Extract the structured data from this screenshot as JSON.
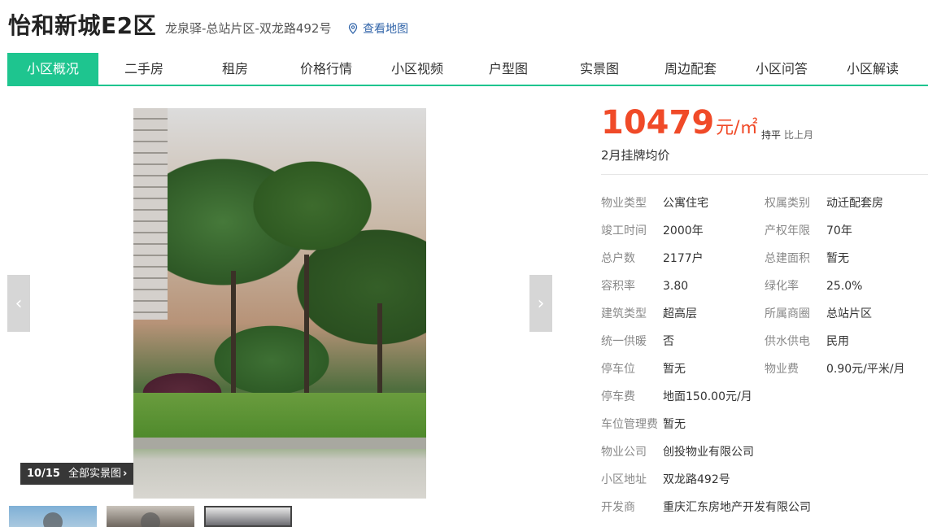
{
  "header": {
    "title": "怡和新城E2区",
    "address": "龙泉驿-总站片区-双龙路492号",
    "map_link": "查看地图"
  },
  "tabs": [
    {
      "label": "小区概况",
      "active": true
    },
    {
      "label": "二手房"
    },
    {
      "label": "租房"
    },
    {
      "label": "价格行情"
    },
    {
      "label": "小区视频"
    },
    {
      "label": "户型图"
    },
    {
      "label": "实景图"
    },
    {
      "label": "周边配套"
    },
    {
      "label": "小区问答"
    },
    {
      "label": "小区解读"
    }
  ],
  "gallery": {
    "counter": "10/15",
    "all_photos": "全部实景图",
    "prev_icon": "chevron-left-icon",
    "next_icon": "chevron-right-icon"
  },
  "price": {
    "value": "10479",
    "unit": "元/㎡",
    "trend": "持平",
    "trend_label": "比上月",
    "subtitle": "2月挂牌均价"
  },
  "info": {
    "rows": [
      [
        {
          "k": "物业类型",
          "v": "公寓住宅"
        },
        {
          "k": "权属类别",
          "v": "动迁配套房"
        }
      ],
      [
        {
          "k": "竣工时间",
          "v": "2000年"
        },
        {
          "k": "产权年限",
          "v": "70年"
        }
      ],
      [
        {
          "k": "总户数",
          "v": "2177户"
        },
        {
          "k": "总建面积",
          "v": "暂无"
        }
      ],
      [
        {
          "k": "容积率",
          "v": "3.80"
        },
        {
          "k": "绿化率",
          "v": "25.0%"
        }
      ],
      [
        {
          "k": "建筑类型",
          "v": "超高层"
        },
        {
          "k": "所属商圈",
          "v": "总站片区"
        }
      ],
      [
        {
          "k": "统一供暖",
          "v": "否"
        },
        {
          "k": "供水供电",
          "v": "民用"
        }
      ],
      [
        {
          "k": "停车位",
          "v": "暂无"
        },
        {
          "k": "物业费",
          "v": "0.90元/平米/月"
        }
      ]
    ],
    "full_rows": [
      {
        "k": "停车费",
        "v": "地面150.00元/月"
      },
      {
        "k": "车位管理费",
        "v": "暂无"
      },
      {
        "k": "物业公司",
        "v": "创投物业有限公司"
      },
      {
        "k": "小区地址",
        "v": "双龙路492号"
      },
      {
        "k": "开发商",
        "v": "重庆汇东房地产开发有限公司"
      }
    ]
  },
  "colors": {
    "accent": "#1ec58f",
    "price": "#f04a28",
    "link": "#3366aa"
  }
}
